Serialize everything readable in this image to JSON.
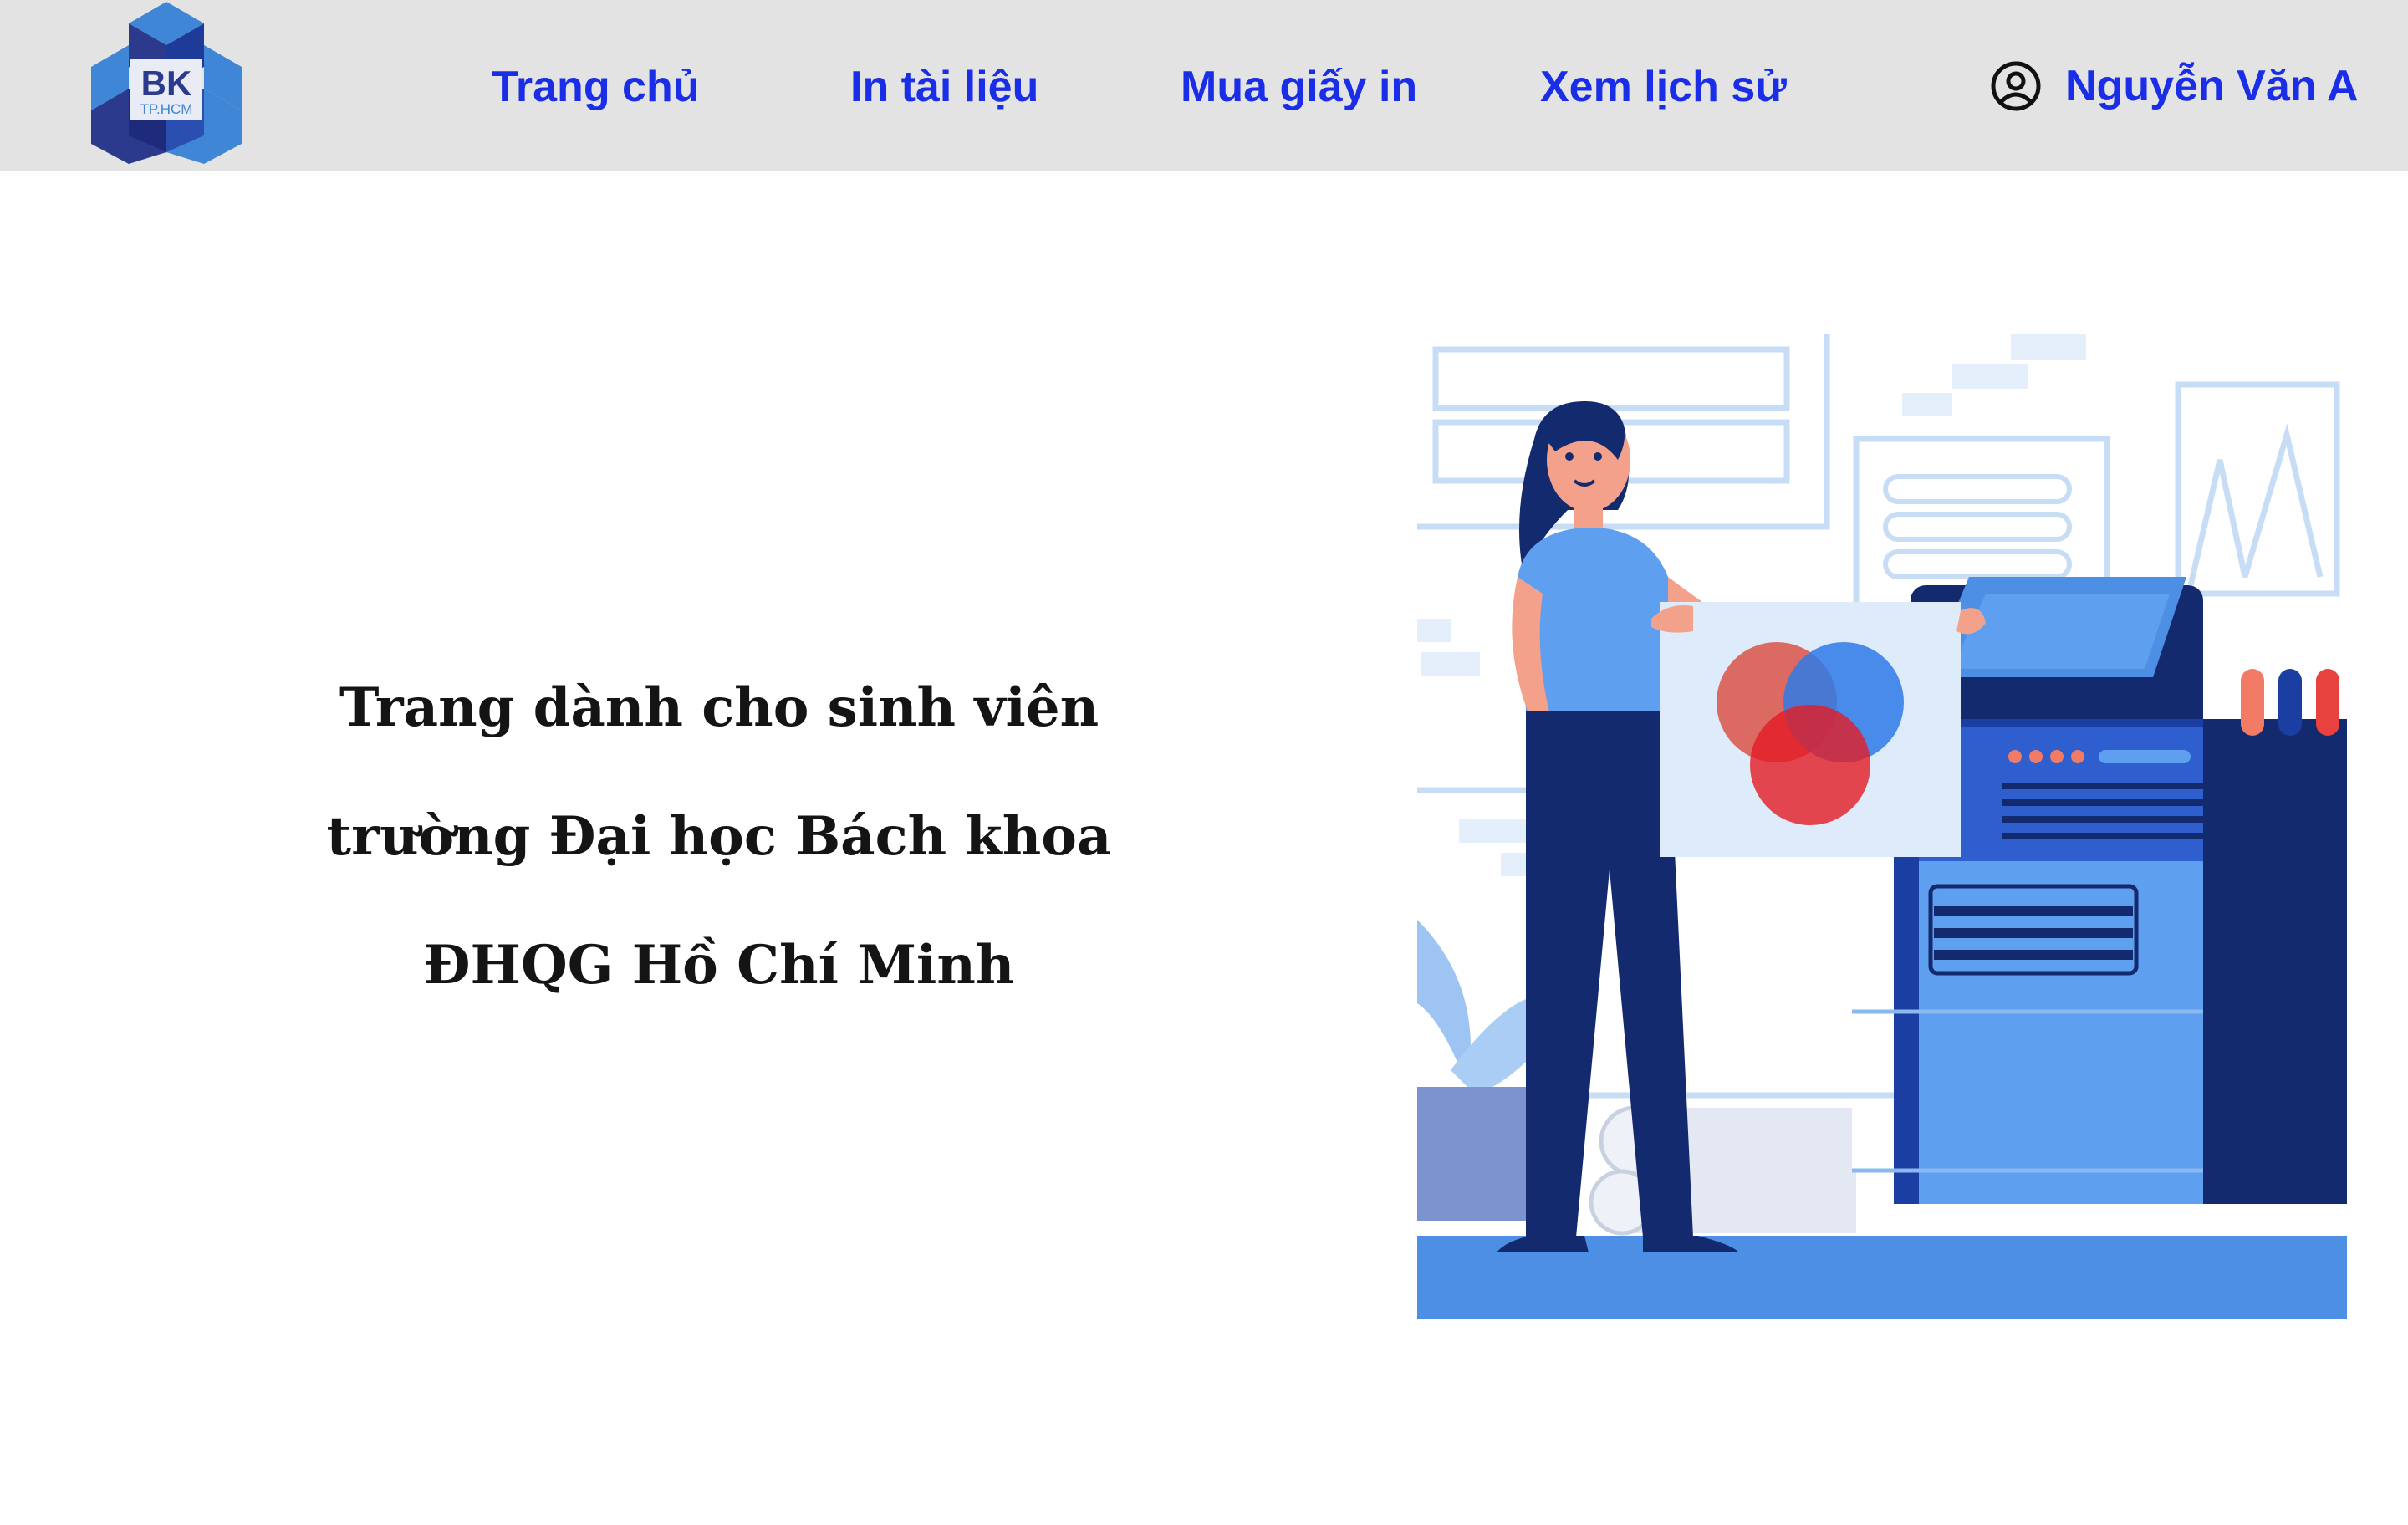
{
  "logo": {
    "text_main": "BK",
    "text_sub": "TP.HCM"
  },
  "nav": {
    "items": [
      {
        "label": "Trang chủ"
      },
      {
        "label": "In tài liệu"
      },
      {
        "label": "Mua giấy in"
      },
      {
        "label": "Xem lịch sử"
      }
    ]
  },
  "user": {
    "name": "Nguyễn Văn A",
    "icon": "user-circle-icon"
  },
  "hero": {
    "lines": [
      "Trang dành cho sinh viên",
      "trường Đại học Bách khoa",
      "ĐHQG Hồ Chí Minh"
    ]
  },
  "colors": {
    "nav_bg": "#e3e3e3",
    "nav_text": "#1a2ee8",
    "logo_dark": "#2b3a8c",
    "logo_light": "#3f86d6",
    "illustration_navy": "#142a6e",
    "illustration_blue": "#4e8fe6"
  }
}
